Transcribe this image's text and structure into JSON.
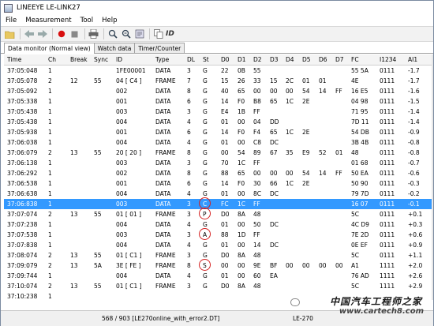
{
  "window": {
    "title": "LINEEYE LE-LINK27"
  },
  "menu": [
    "File",
    "Measurement",
    "Tool",
    "Help"
  ],
  "toolbar": {
    "icons": [
      "open-icon",
      "back-icon",
      "forward-icon",
      "record-icon",
      "stop-icon",
      "print-icon",
      "search-icon",
      "search-next-icon",
      "config-icon",
      "copy-icon"
    ],
    "id_label": "ID"
  },
  "tabs": [
    {
      "label": "Data monitor (Normal view)",
      "active": true
    },
    {
      "label": "Watch data",
      "active": false
    },
    {
      "label": "Timer/Counter",
      "active": false
    }
  ],
  "columns": [
    "Time",
    "Ch",
    "Break",
    "Sync",
    "ID",
    "Type",
    "DL",
    "St",
    "D0",
    "D1",
    "D2",
    "D3",
    "D4",
    "D5",
    "D6",
    "D7",
    "FC",
    "I1234",
    "AI1"
  ],
  "rows": [
    [
      "37:05:048",
      "1",
      "",
      "",
      "1FE00001",
      "DATA",
      "3",
      "G",
      "22",
      "0B",
      "55",
      "",
      "",
      "",
      "",
      "",
      "55 5A",
      "0111",
      "-1.7"
    ],
    [
      "37:05:078",
      "2",
      "12",
      "55",
      "04 [ C4 ]",
      "FRAME",
      "7",
      "G",
      "15",
      "26",
      "33",
      "15",
      "2C",
      "01",
      "01",
      "",
      "4E",
      "0111",
      "-1.7"
    ],
    [
      "37:05:092",
      "1",
      "",
      "",
      "002",
      "DATA",
      "8",
      "G",
      "40",
      "65",
      "00",
      "00",
      "00",
      "54",
      "14",
      "FF",
      "16 E5",
      "0111",
      "-1.6"
    ],
    [
      "37:05:338",
      "1",
      "",
      "",
      "001",
      "DATA",
      "6",
      "G",
      "14",
      "F0",
      "B8",
      "65",
      "1C",
      "2E",
      "",
      "",
      "04 98",
      "0111",
      "-1.5"
    ],
    [
      "37:05:438",
      "1",
      "",
      "",
      "003",
      "DATA",
      "3",
      "G",
      "E4",
      "1B",
      "FF",
      "",
      "",
      "",
      "",
      "",
      "71 95",
      "0111",
      "-1.4"
    ],
    [
      "37:05:438",
      "1",
      "",
      "",
      "004",
      "DATA",
      "4",
      "G",
      "01",
      "00",
      "04",
      "DD",
      "",
      "",
      "",
      "",
      "7D 11",
      "0111",
      "-1.4"
    ],
    [
      "37:05:938",
      "1",
      "",
      "",
      "001",
      "DATA",
      "6",
      "G",
      "14",
      "F0",
      "F4",
      "65",
      "1C",
      "2E",
      "",
      "",
      "54 DB",
      "0111",
      "-0.9"
    ],
    [
      "37:06:038",
      "1",
      "",
      "",
      "004",
      "DATA",
      "4",
      "G",
      "01",
      "00",
      "C8",
      "DC",
      "",
      "",
      "",
      "",
      "3B 4B",
      "0111",
      "-0.8"
    ],
    [
      "37:06:079",
      "2",
      "13",
      "55",
      "20 [ 20 ]",
      "FRAME",
      "8",
      "G",
      "00",
      "54",
      "89",
      "67",
      "35",
      "E9",
      "52",
      "01",
      "48",
      "0111",
      "-0.8"
    ],
    [
      "37:06:138",
      "1",
      "",
      "",
      "003",
      "DATA",
      "3",
      "G",
      "70",
      "1C",
      "FF",
      "",
      "",
      "",
      "",
      "",
      "01 68",
      "0111",
      "-0.7"
    ],
    [
      "37:06:292",
      "1",
      "",
      "",
      "002",
      "DATA",
      "8",
      "G",
      "88",
      "65",
      "00",
      "00",
      "00",
      "54",
      "14",
      "FF",
      "50 EA",
      "0111",
      "-0.6"
    ],
    [
      "37:06:538",
      "1",
      "",
      "",
      "001",
      "DATA",
      "6",
      "G",
      "14",
      "F0",
      "30",
      "66",
      "1C",
      "2E",
      "",
      "",
      "50 90",
      "0111",
      "-0.3"
    ],
    [
      "37:06:638",
      "1",
      "",
      "",
      "004",
      "DATA",
      "4",
      "G",
      "01",
      "00",
      "8C",
      "DC",
      "",
      "",
      "",
      "",
      "79 7D",
      "0111",
      "-0.2"
    ],
    [
      "37:06:838",
      "1",
      "",
      "",
      "003",
      "DATA",
      "3",
      "C",
      "FC",
      "1C",
      "FF",
      "",
      "",
      "",
      "",
      "",
      "16 07",
      "0111",
      "-0.1"
    ],
    [
      "37:07:074",
      "2",
      "13",
      "55",
      "01 [ 01 ]",
      "FRAME",
      "3",
      "P",
      "D0",
      "8A",
      "48",
      "",
      "",
      "",
      "",
      "",
      "5C",
      "0111",
      "+0.1"
    ],
    [
      "37:07:238",
      "1",
      "",
      "",
      "004",
      "DATA",
      "4",
      "G",
      "01",
      "00",
      "50",
      "DC",
      "",
      "",
      "",
      "",
      "4C D9",
      "0111",
      "+0.3"
    ],
    [
      "37:07:538",
      "1",
      "",
      "",
      "003",
      "DATA",
      "3",
      "A",
      "88",
      "1D",
      "FF",
      "",
      "",
      "",
      "",
      "",
      "7E 2D",
      "0111",
      "+0.6"
    ],
    [
      "37:07:838",
      "1",
      "",
      "",
      "004",
      "DATA",
      "4",
      "G",
      "01",
      "00",
      "14",
      "DC",
      "",
      "",
      "",
      "",
      "0E EF",
      "0111",
      "+0.9"
    ],
    [
      "37:08:074",
      "2",
      "13",
      "55",
      "01 [ C1 ]",
      "FRAME",
      "3",
      "G",
      "D0",
      "8A",
      "48",
      "",
      "",
      "",
      "",
      "",
      "5C",
      "0111",
      "+1.1"
    ],
    [
      "37:09:079",
      "2",
      "13",
      "5A",
      "3E [ FE ]",
      "FRAME",
      "8",
      "S",
      "00",
      "00",
      "9E",
      "BF",
      "00",
      "00",
      "00",
      "00",
      "A1",
      "1111",
      "+2.0"
    ],
    [
      "37:09:744",
      "1",
      "",
      "",
      "004",
      "DATA",
      "4",
      "G",
      "01",
      "00",
      "60",
      "EA",
      "",
      "",
      "",
      "",
      "76 AD",
      "1111",
      "+2.6"
    ],
    [
      "37:10:074",
      "2",
      "13",
      "55",
      "01 [ C1 ]",
      "FRAME",
      "3",
      "G",
      "D0",
      "8A",
      "48",
      "",
      "",
      "",
      "",
      "",
      "5C",
      "1111",
      "+2.9"
    ],
    [
      "37:10:238",
      "1",
      "",
      "",
      "",
      "",
      "",
      "",
      "",
      "",
      "",
      "",
      "",
      "",
      "",
      "",
      "",
      "",
      ""
    ]
  ],
  "selected_row": 13,
  "circled_rows": [
    13,
    14,
    16,
    19
  ],
  "status": {
    "position": "568 / 903 [LE270online_with_error2.DT]",
    "device": "LE-270"
  },
  "watermark": {
    "logo": "中国汽车工程师之家",
    "site": "www.cartech8.com"
  },
  "colors": {
    "selection": "#3399ff",
    "circle": "#d42020"
  }
}
